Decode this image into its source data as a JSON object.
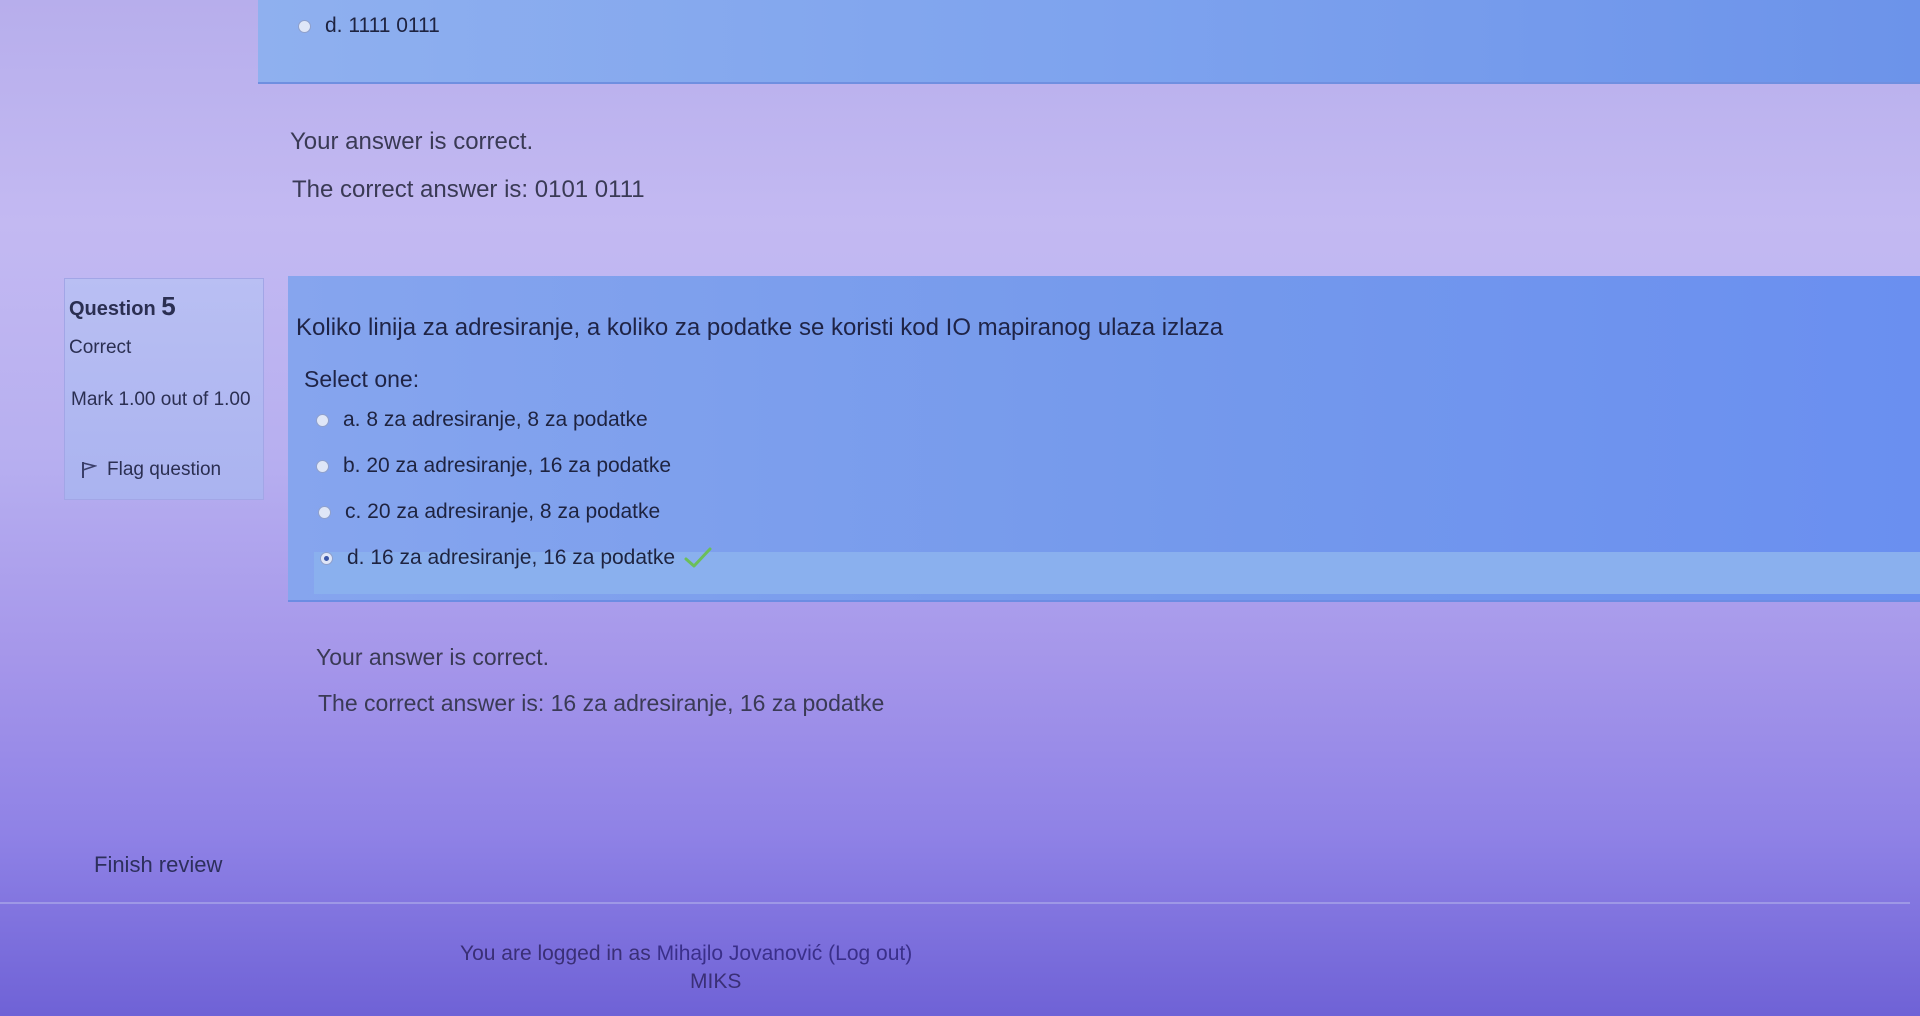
{
  "previous_question": {
    "option_d_label": "d. 1111 0111",
    "feedback_correct": "Your answer is correct.",
    "correct_answer_text": "The correct answer is: 0101 0111"
  },
  "question": {
    "label": "Question",
    "number": "5",
    "state": "Correct",
    "grade": "Mark 1.00 out of 1.00",
    "flag_label": "Flag question",
    "text": "Koliko linija za adresiranje, a koliko za podatke se koristi kod IO mapiranog ulaza izlaza",
    "prompt": "Select one:",
    "options": [
      {
        "label": "a. 8 za adresiranje, 8 za podatke",
        "selected": false
      },
      {
        "label": "b. 20 za adresiranje, 16 za podatke",
        "selected": false
      },
      {
        "label": "c. 20 za adresiranje, 8 za podatke",
        "selected": false
      },
      {
        "label": "d. 16 za adresiranje, 16 za podatke",
        "selected": true
      }
    ],
    "feedback_correct": "Your answer is correct.",
    "correct_answer_text": "The correct answer is: 16 za adresiranje, 16 za podatke"
  },
  "finish_review_label": "Finish review",
  "footer": {
    "logged_in_prefix": "You are logged in as",
    "user_name": "Mihajlo Jovanović",
    "logout_label": "(Log out)",
    "site_name": "MIKS"
  },
  "icons": {
    "flag": "flag-icon",
    "correct": "check-icon"
  },
  "colors": {
    "answer_box": "#7a9eee",
    "correct_check": "#6bbf59"
  }
}
